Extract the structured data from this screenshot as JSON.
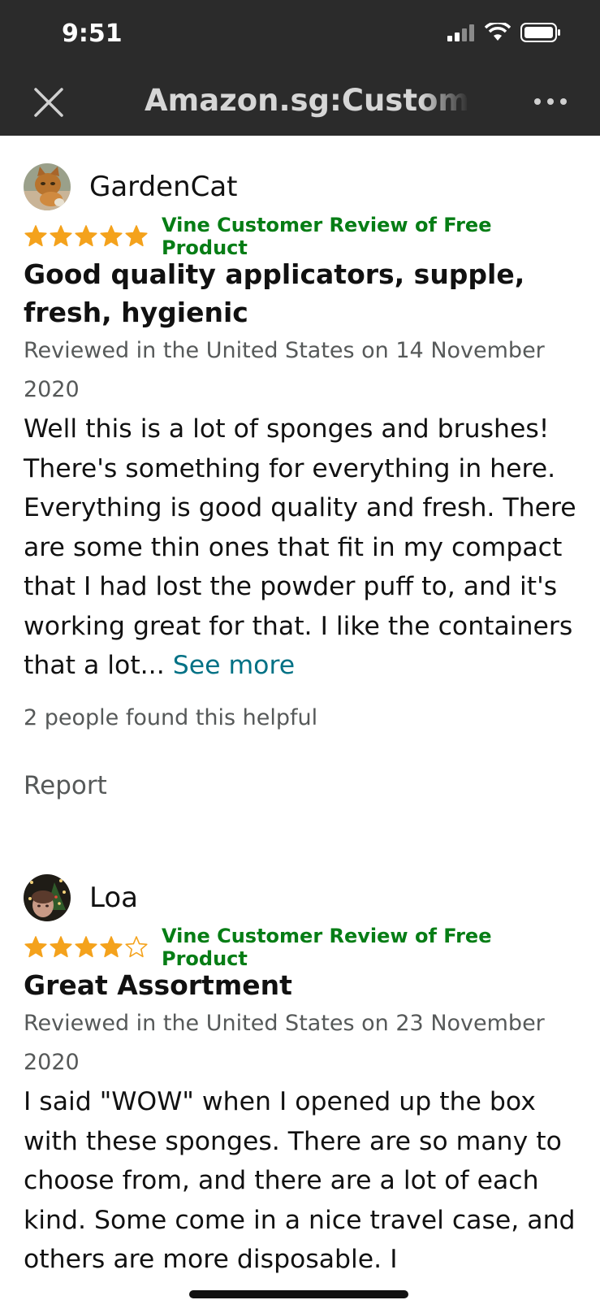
{
  "status_bar": {
    "time": "9:51"
  },
  "nav": {
    "title": "Amazon.sg:Customer"
  },
  "colors": {
    "star": "#f4a21c",
    "vine": "#067d15",
    "link": "#007185",
    "muted": "#565959",
    "bar": "#2b2b2b"
  },
  "reviews": [
    {
      "reviewer": "GardenCat",
      "rating": 5,
      "badge": "Vine Customer Review of Free Product",
      "title": "Good quality applicators, supple, fresh, hygienic",
      "date": "Reviewed in the United States on 14 November 2020",
      "body": "Well this is a lot of sponges and brushes! There's something for everything in here. Everything is good quality and fresh. There are some thin ones that fit in my compact that I had lost the powder puff to, and it's working great for that. I like the containers that a lot...",
      "see_more": "See more",
      "helpful": "2 people found this helpful",
      "report": "Report"
    },
    {
      "reviewer": "Loa",
      "rating": 4,
      "badge": "Vine Customer Review of Free Product",
      "title": "Great Assortment",
      "date": "Reviewed in the United States on 23 November 2020",
      "body": "I said \"WOW\" when I opened up the box with these sponges. There are so many to choose from, and there are a lot of each kind. Some come in a nice travel case, and others are more disposable. I"
    }
  ]
}
